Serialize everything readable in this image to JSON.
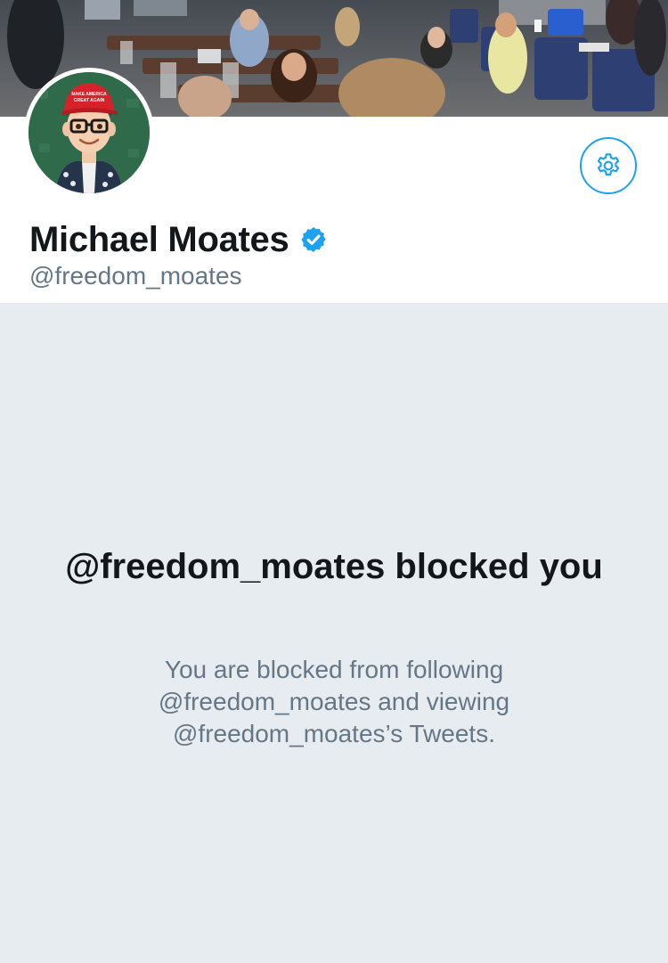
{
  "profile": {
    "name": "Michael Moates",
    "handle": "@freedom_moates",
    "verified": true
  },
  "blocked": {
    "title": "@freedom_moates blocked you",
    "description": "You are blocked from following @freedom_moates and viewing @freedom_moates’s Tweets."
  },
  "avatar": {
    "hat_text": "MAKE AMERICA GREAT AGAIN"
  },
  "colors": {
    "accent": "#1da1f2",
    "background": "#e6ecf0",
    "text_primary": "#14171a",
    "text_secondary": "#657786"
  },
  "icons": {
    "settings": "gear-icon",
    "verified": "verified-badge-icon"
  }
}
